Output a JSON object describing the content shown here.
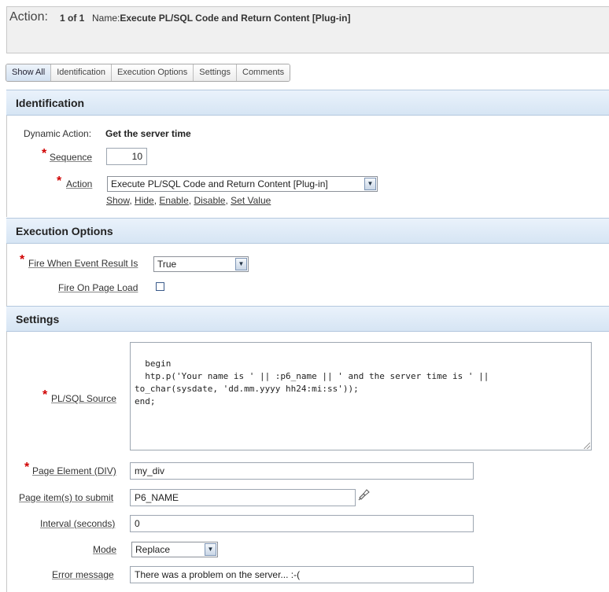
{
  "header": {
    "title": "Action:",
    "count": "1 of 1",
    "name_label": "Name:",
    "name_value": "Execute PL/SQL Code and Return Content [Plug-in]"
  },
  "tabs": [
    {
      "label": "Show All",
      "active": true
    },
    {
      "label": "Identification",
      "active": false
    },
    {
      "label": "Execution Options",
      "active": false
    },
    {
      "label": "Settings",
      "active": false
    },
    {
      "label": "Comments",
      "active": false
    }
  ],
  "identification": {
    "heading": "Identification",
    "dynamic_action_label": "Dynamic Action:",
    "dynamic_action_value": "Get the server time",
    "sequence_label": "Sequence",
    "sequence_value": "10",
    "action_label": "Action",
    "action_value": "Execute PL/SQL Code and Return Content [Plug-in]",
    "shortcuts": [
      "Show",
      "Hide",
      "Enable",
      "Disable",
      "Set Value"
    ]
  },
  "execution_options": {
    "heading": "Execution Options",
    "fire_when_label": "Fire When Event Result Is",
    "fire_when_value": "True",
    "fire_on_load_label": "Fire On Page Load",
    "fire_on_load_checked": false
  },
  "settings": {
    "heading": "Settings",
    "plsql_label": "PL/SQL Source",
    "plsql_value": "begin\n  htp.p('Your name is ' || :p6_name || ' and the server time is ' ||\nto_char(sysdate, 'dd.mm.yyyy hh24:mi:ss'));\nend;",
    "page_element_label": "Page Element (DIV)",
    "page_element_value": "my_div",
    "items_submit_label": "Page item(s) to submit",
    "items_submit_value": "P6_NAME",
    "interval_label": "Interval (seconds)",
    "interval_value": "0",
    "mode_label": "Mode",
    "mode_value": "Replace",
    "error_label": "Error message",
    "error_value": "There was a problem on the server... :-("
  },
  "required_marker": "*"
}
